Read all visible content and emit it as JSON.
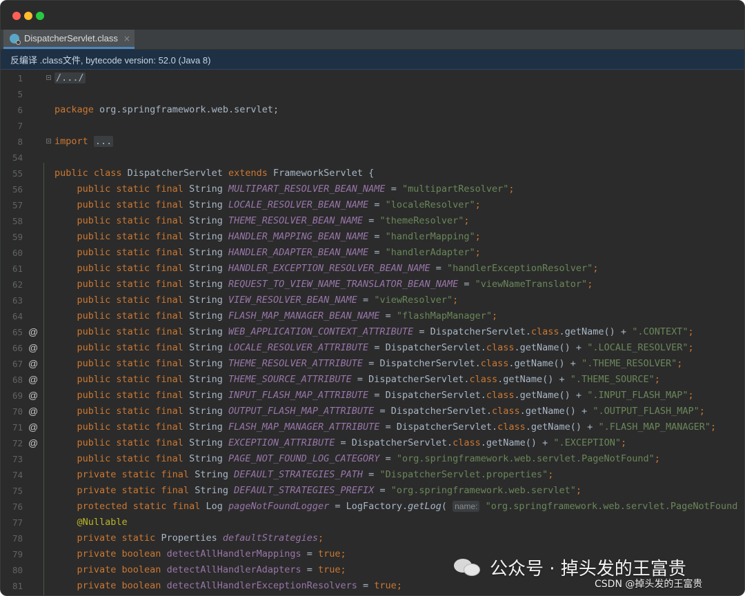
{
  "window": {
    "controls": [
      "close",
      "minimize",
      "maximize"
    ]
  },
  "tab": {
    "label": "DispatcherServlet.class",
    "close_glyph": "×",
    "icon": "class-file-icon"
  },
  "notice": "反编译 .class文件, bytecode version: 52.0 (Java 8)",
  "lines": [
    {
      "n": "1",
      "fold": true,
      "tokens": [
        {
          "t": "/.../",
          "c": "collapsed"
        }
      ]
    },
    {
      "n": "5",
      "tokens": []
    },
    {
      "n": "6",
      "tokens": [
        {
          "t": "package ",
          "c": "kw"
        },
        {
          "t": "org.springframework.web.servlet;",
          "c": ""
        }
      ]
    },
    {
      "n": "7",
      "tokens": []
    },
    {
      "n": "8",
      "fold": true,
      "tokens": [
        {
          "t": "import ",
          "c": "kw"
        },
        {
          "t": "...",
          "c": "collapsed"
        }
      ]
    },
    {
      "n": "54",
      "tokens": []
    },
    {
      "n": "55",
      "tokens": [
        {
          "t": "public class ",
          "c": "kw"
        },
        {
          "t": "DispatcherServlet ",
          "c": ""
        },
        {
          "t": "extends ",
          "c": "kw"
        },
        {
          "t": "FrameworkServlet {",
          "c": ""
        }
      ]
    },
    {
      "n": "56",
      "tokens": [
        {
          "t": "    public static final ",
          "c": "kw"
        },
        {
          "t": "String ",
          "c": ""
        },
        {
          "t": "MULTIPART_RESOLVER_BEAN_NAME",
          "c": "const"
        },
        {
          "t": " = ",
          "c": ""
        },
        {
          "t": "\"multipartResolver\"",
          "c": "str"
        },
        {
          "t": ";",
          "c": "kw"
        }
      ]
    },
    {
      "n": "57",
      "tokens": [
        {
          "t": "    public static final ",
          "c": "kw"
        },
        {
          "t": "String ",
          "c": ""
        },
        {
          "t": "LOCALE_RESOLVER_BEAN_NAME",
          "c": "const"
        },
        {
          "t": " = ",
          "c": ""
        },
        {
          "t": "\"localeResolver\"",
          "c": "str"
        },
        {
          "t": ";",
          "c": "kw"
        }
      ]
    },
    {
      "n": "58",
      "tokens": [
        {
          "t": "    public static final ",
          "c": "kw"
        },
        {
          "t": "String ",
          "c": ""
        },
        {
          "t": "THEME_RESOLVER_BEAN_NAME",
          "c": "const"
        },
        {
          "t": " = ",
          "c": ""
        },
        {
          "t": "\"themeResolver\"",
          "c": "str"
        },
        {
          "t": ";",
          "c": "kw"
        }
      ]
    },
    {
      "n": "59",
      "tokens": [
        {
          "t": "    public static final ",
          "c": "kw"
        },
        {
          "t": "String ",
          "c": ""
        },
        {
          "t": "HANDLER_MAPPING_BEAN_NAME",
          "c": "const"
        },
        {
          "t": " = ",
          "c": ""
        },
        {
          "t": "\"handlerMapping\"",
          "c": "str"
        },
        {
          "t": ";",
          "c": "kw"
        }
      ]
    },
    {
      "n": "60",
      "tokens": [
        {
          "t": "    public static final ",
          "c": "kw"
        },
        {
          "t": "String ",
          "c": ""
        },
        {
          "t": "HANDLER_ADAPTER_BEAN_NAME",
          "c": "const"
        },
        {
          "t": " = ",
          "c": ""
        },
        {
          "t": "\"handlerAdapter\"",
          "c": "str"
        },
        {
          "t": ";",
          "c": "kw"
        }
      ]
    },
    {
      "n": "61",
      "tokens": [
        {
          "t": "    public static final ",
          "c": "kw"
        },
        {
          "t": "String ",
          "c": ""
        },
        {
          "t": "HANDLER_EXCEPTION_RESOLVER_BEAN_NAME",
          "c": "const"
        },
        {
          "t": " = ",
          "c": ""
        },
        {
          "t": "\"handlerExceptionResolver\"",
          "c": "str"
        },
        {
          "t": ";",
          "c": "kw"
        }
      ]
    },
    {
      "n": "62",
      "tokens": [
        {
          "t": "    public static final ",
          "c": "kw"
        },
        {
          "t": "String ",
          "c": ""
        },
        {
          "t": "REQUEST_TO_VIEW_NAME_TRANSLATOR_BEAN_NAME",
          "c": "const"
        },
        {
          "t": " = ",
          "c": ""
        },
        {
          "t": "\"viewNameTranslator\"",
          "c": "str"
        },
        {
          "t": ";",
          "c": "kw"
        }
      ]
    },
    {
      "n": "63",
      "tokens": [
        {
          "t": "    public static final ",
          "c": "kw"
        },
        {
          "t": "String ",
          "c": ""
        },
        {
          "t": "VIEW_RESOLVER_BEAN_NAME",
          "c": "const"
        },
        {
          "t": " = ",
          "c": ""
        },
        {
          "t": "\"viewResolver\"",
          "c": "str"
        },
        {
          "t": ";",
          "c": "kw"
        }
      ]
    },
    {
      "n": "64",
      "tokens": [
        {
          "t": "    public static final ",
          "c": "kw"
        },
        {
          "t": "String ",
          "c": ""
        },
        {
          "t": "FLASH_MAP_MANAGER_BEAN_NAME",
          "c": "const"
        },
        {
          "t": " = ",
          "c": ""
        },
        {
          "t": "\"flashMapManager\"",
          "c": "str"
        },
        {
          "t": ";",
          "c": "kw"
        }
      ]
    },
    {
      "n": "65",
      "at": "@",
      "tokens": [
        {
          "t": "    public static final ",
          "c": "kw"
        },
        {
          "t": "String ",
          "c": ""
        },
        {
          "t": "WEB_APPLICATION_CONTEXT_ATTRIBUTE",
          "c": "const"
        },
        {
          "t": " = DispatcherServlet.",
          "c": ""
        },
        {
          "t": "class",
          "c": "kw"
        },
        {
          "t": ".getName() + ",
          "c": ""
        },
        {
          "t": "\".CONTEXT\"",
          "c": "str"
        },
        {
          "t": ";",
          "c": "kw"
        }
      ]
    },
    {
      "n": "66",
      "at": "@",
      "tokens": [
        {
          "t": "    public static final ",
          "c": "kw"
        },
        {
          "t": "String ",
          "c": ""
        },
        {
          "t": "LOCALE_RESOLVER_ATTRIBUTE",
          "c": "const"
        },
        {
          "t": " = DispatcherServlet.",
          "c": ""
        },
        {
          "t": "class",
          "c": "kw"
        },
        {
          "t": ".getName() + ",
          "c": ""
        },
        {
          "t": "\".LOCALE_RESOLVER\"",
          "c": "str"
        },
        {
          "t": ";",
          "c": "kw"
        }
      ]
    },
    {
      "n": "67",
      "at": "@",
      "tokens": [
        {
          "t": "    public static final ",
          "c": "kw"
        },
        {
          "t": "String ",
          "c": ""
        },
        {
          "t": "THEME_RESOLVER_ATTRIBUTE",
          "c": "const"
        },
        {
          "t": " = DispatcherServlet.",
          "c": ""
        },
        {
          "t": "class",
          "c": "kw"
        },
        {
          "t": ".getName() + ",
          "c": ""
        },
        {
          "t": "\".THEME_RESOLVER\"",
          "c": "str"
        },
        {
          "t": ";",
          "c": "kw"
        }
      ]
    },
    {
      "n": "68",
      "at": "@",
      "tokens": [
        {
          "t": "    public static final ",
          "c": "kw"
        },
        {
          "t": "String ",
          "c": ""
        },
        {
          "t": "THEME_SOURCE_ATTRIBUTE",
          "c": "const"
        },
        {
          "t": " = DispatcherServlet.",
          "c": ""
        },
        {
          "t": "class",
          "c": "kw"
        },
        {
          "t": ".getName() + ",
          "c": ""
        },
        {
          "t": "\".THEME_SOURCE\"",
          "c": "str"
        },
        {
          "t": ";",
          "c": "kw"
        }
      ]
    },
    {
      "n": "69",
      "at": "@",
      "tokens": [
        {
          "t": "    public static final ",
          "c": "kw"
        },
        {
          "t": "String ",
          "c": ""
        },
        {
          "t": "INPUT_FLASH_MAP_ATTRIBUTE",
          "c": "const"
        },
        {
          "t": " = DispatcherServlet.",
          "c": ""
        },
        {
          "t": "class",
          "c": "kw"
        },
        {
          "t": ".getName() + ",
          "c": ""
        },
        {
          "t": "\".INPUT_FLASH_MAP\"",
          "c": "str"
        },
        {
          "t": ";",
          "c": "kw"
        }
      ]
    },
    {
      "n": "70",
      "at": "@",
      "tokens": [
        {
          "t": "    public static final ",
          "c": "kw"
        },
        {
          "t": "String ",
          "c": ""
        },
        {
          "t": "OUTPUT_FLASH_MAP_ATTRIBUTE",
          "c": "const"
        },
        {
          "t": " = DispatcherServlet.",
          "c": ""
        },
        {
          "t": "class",
          "c": "kw"
        },
        {
          "t": ".getName() + ",
          "c": ""
        },
        {
          "t": "\".OUTPUT_FLASH_MAP\"",
          "c": "str"
        },
        {
          "t": ";",
          "c": "kw"
        }
      ]
    },
    {
      "n": "71",
      "at": "@",
      "tokens": [
        {
          "t": "    public static final ",
          "c": "kw"
        },
        {
          "t": "String ",
          "c": ""
        },
        {
          "t": "FLASH_MAP_MANAGER_ATTRIBUTE",
          "c": "const"
        },
        {
          "t": " = DispatcherServlet.",
          "c": ""
        },
        {
          "t": "class",
          "c": "kw"
        },
        {
          "t": ".getName() + ",
          "c": ""
        },
        {
          "t": "\".FLASH_MAP_MANAGER\"",
          "c": "str"
        },
        {
          "t": ";",
          "c": "kw"
        }
      ]
    },
    {
      "n": "72",
      "at": "@",
      "tokens": [
        {
          "t": "    public static final ",
          "c": "kw"
        },
        {
          "t": "String ",
          "c": ""
        },
        {
          "t": "EXCEPTION_ATTRIBUTE",
          "c": "const"
        },
        {
          "t": " = DispatcherServlet.",
          "c": ""
        },
        {
          "t": "class",
          "c": "kw"
        },
        {
          "t": ".getName() + ",
          "c": ""
        },
        {
          "t": "\".EXCEPTION\"",
          "c": "str"
        },
        {
          "t": ";",
          "c": "kw"
        }
      ]
    },
    {
      "n": "73",
      "tokens": [
        {
          "t": "    public static final ",
          "c": "kw"
        },
        {
          "t": "String ",
          "c": ""
        },
        {
          "t": "PAGE_NOT_FOUND_LOG_CATEGORY",
          "c": "const"
        },
        {
          "t": " = ",
          "c": ""
        },
        {
          "t": "\"org.springframework.web.servlet.PageNotFound\"",
          "c": "str"
        },
        {
          "t": ";",
          "c": "kw"
        }
      ]
    },
    {
      "n": "74",
      "tokens": [
        {
          "t": "    private static final ",
          "c": "kw"
        },
        {
          "t": "String ",
          "c": ""
        },
        {
          "t": "DEFAULT_STRATEGIES_PATH",
          "c": "const"
        },
        {
          "t": " = ",
          "c": ""
        },
        {
          "t": "\"DispatcherServlet.properties\"",
          "c": "str"
        },
        {
          "t": ";",
          "c": "kw"
        }
      ]
    },
    {
      "n": "75",
      "tokens": [
        {
          "t": "    private static final ",
          "c": "kw"
        },
        {
          "t": "String ",
          "c": ""
        },
        {
          "t": "DEFAULT_STRATEGIES_PREFIX",
          "c": "const"
        },
        {
          "t": " = ",
          "c": ""
        },
        {
          "t": "\"org.springframework.web.servlet\"",
          "c": "str"
        },
        {
          "t": ";",
          "c": "kw"
        }
      ]
    },
    {
      "n": "76",
      "tokens": [
        {
          "t": "    protected static final ",
          "c": "kw"
        },
        {
          "t": "Log ",
          "c": ""
        },
        {
          "t": "pageNotFoundLogger",
          "c": "const"
        },
        {
          "t": " = LogFactory.",
          "c": ""
        },
        {
          "t": "getLog",
          "c": "it"
        },
        {
          "t": "( ",
          "c": ""
        },
        {
          "t": "name:",
          "c": "hint"
        },
        {
          "t": " ",
          "c": ""
        },
        {
          "t": "\"org.springframework.web.servlet.PageNotFound",
          "c": "str"
        }
      ]
    },
    {
      "n": "77",
      "tokens": [
        {
          "t": "    @Nullable",
          "c": "ann"
        }
      ]
    },
    {
      "n": "78",
      "tokens": [
        {
          "t": "    private static ",
          "c": "kw"
        },
        {
          "t": "Properties ",
          "c": ""
        },
        {
          "t": "defaultStrategies",
          "c": "const"
        },
        {
          "t": ";",
          "c": "kw"
        }
      ]
    },
    {
      "n": "79",
      "tokens": [
        {
          "t": "    private boolean ",
          "c": "kw"
        },
        {
          "t": "detectAllHandlerMappings",
          "c": "field"
        },
        {
          "t": " = ",
          "c": ""
        },
        {
          "t": "true",
          "c": "kw"
        },
        {
          "t": ";",
          "c": "kw"
        }
      ]
    },
    {
      "n": "80",
      "tokens": [
        {
          "t": "    private boolean ",
          "c": "kw"
        },
        {
          "t": "detectAllHandlerAdapters",
          "c": "field"
        },
        {
          "t": " = ",
          "c": ""
        },
        {
          "t": "true",
          "c": "kw"
        },
        {
          "t": ";",
          "c": "kw"
        }
      ]
    },
    {
      "n": "81",
      "tokens": [
        {
          "t": "    private boolean ",
          "c": "kw"
        },
        {
          "t": "detectAllHandlerExceptionResolvers",
          "c": "field"
        },
        {
          "t": " = ",
          "c": ""
        },
        {
          "t": "true",
          "c": "kw"
        },
        {
          "t": ";",
          "c": "kw"
        }
      ]
    }
  ],
  "watermark": {
    "text": "公众号 · 掉头发的王富贵",
    "icon": "wechat-icon"
  },
  "csdn_credit": "CSDN @掉头发的王富贵",
  "colors": {
    "background": "#2b2b2b",
    "keyword": "#cc7832",
    "constant": "#9876aa",
    "string": "#6a8759",
    "annotation": "#bbb529",
    "plain": "#a9b7c6",
    "line_number": "#606366",
    "notice_bg": "#1e3044"
  }
}
